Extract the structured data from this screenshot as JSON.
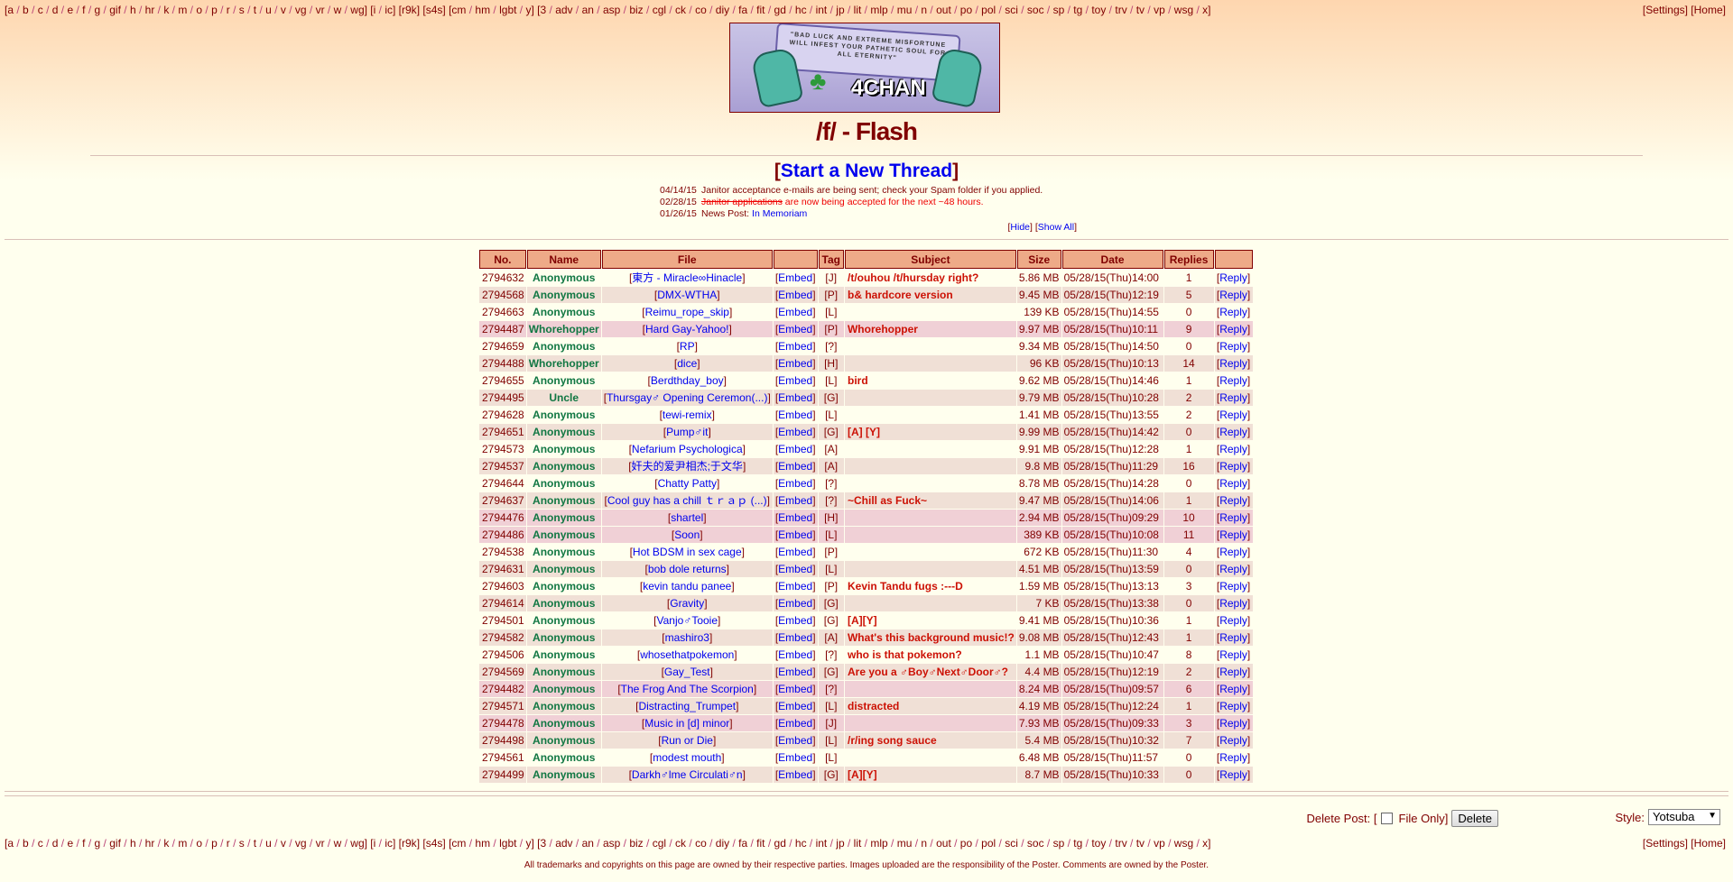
{
  "boards_groups": [
    [
      "a",
      "b",
      "c",
      "d",
      "e",
      "f",
      "g",
      "gif",
      "h",
      "hr",
      "k",
      "m",
      "o",
      "p",
      "r",
      "s",
      "t",
      "u",
      "v",
      "vg",
      "vr",
      "w",
      "wg"
    ],
    [
      "i",
      "ic"
    ],
    [
      "r9k"
    ],
    [
      "s4s"
    ],
    [
      "cm",
      "hm",
      "lgbt",
      "y"
    ],
    [
      "3",
      "adv",
      "an",
      "asp",
      "biz",
      "cgl",
      "ck",
      "co",
      "diy",
      "fa",
      "fit",
      "gd",
      "hc",
      "int",
      "jp",
      "lit",
      "mlp",
      "mu",
      "n",
      "out",
      "po",
      "pol",
      "sci",
      "soc",
      "sp",
      "tg",
      "toy",
      "trv",
      "tv",
      "vp",
      "wsg",
      "x"
    ]
  ],
  "nav_right": {
    "settings": "Settings",
    "home": "Home"
  },
  "banner": {
    "text": "\"BAD LUCK AND EXTREME MISFORTUNE WILL INFEST YOUR PATHETIC SOUL FOR ALL ETERNITY\"",
    "logo": "4CHAN"
  },
  "board_title": "/f/ - Flash",
  "start_thread": "Start a New Thread",
  "news": [
    {
      "date": "04/14/15",
      "text": "Janitor acceptance e-mails are being sent; check your Spam folder if you applied."
    },
    {
      "date": "02/28/15",
      "strike": "Janitor applications",
      "text": " are now being accepted for the next ~48 hours."
    },
    {
      "date": "01/26/15",
      "text": "News Post: ",
      "link": "In Memoriam"
    }
  ],
  "news_ctl": {
    "hide": "Hide",
    "show_all": "Show All"
  },
  "table": {
    "headers": [
      "No.",
      "Name",
      "File",
      "",
      "Tag",
      "Subject",
      "Size",
      "Date",
      "Replies",
      ""
    ],
    "embed_label": "Embed",
    "reply_label": "Reply",
    "rows": [
      {
        "no": "2794632",
        "name": "Anonymous",
        "file": "東方 - Miracle∞Hinacle",
        "tag": "J",
        "subj": "/t/ouhou /t/hursday right?",
        "size": "5.86 MB",
        "date": "05/28/15(Thu)14:00",
        "rep": "1"
      },
      {
        "no": "2794568",
        "name": "Anonymous",
        "file": "DMX-WTHA",
        "tag": "P",
        "subj": "b& hardcore version",
        "size": "9.45 MB",
        "date": "05/28/15(Thu)12:19",
        "rep": "5"
      },
      {
        "no": "2794663",
        "name": "Anonymous",
        "file": "Reimu_rope_skip",
        "tag": "L",
        "subj": "",
        "size": "139 KB",
        "date": "05/28/15(Thu)14:55",
        "rep": "0"
      },
      {
        "no": "2794487",
        "name": "Whorehopper",
        "file": "Hard Gay-Yahoo!",
        "tag": "P",
        "subj": "Whorehopper",
        "size": "9.97 MB",
        "date": "05/28/15(Thu)10:11",
        "rep": "9",
        "hl": true
      },
      {
        "no": "2794659",
        "name": "Anonymous",
        "file": "RP",
        "tag": "?",
        "subj": "",
        "size": "9.34 MB",
        "date": "05/28/15(Thu)14:50",
        "rep": "0"
      },
      {
        "no": "2794488",
        "name": "Whorehopper",
        "file": "dice",
        "tag": "H",
        "subj": "",
        "size": "96 KB",
        "date": "05/28/15(Thu)10:13",
        "rep": "14"
      },
      {
        "no": "2794655",
        "name": "Anonymous",
        "file": "Berdthday_boy",
        "tag": "L",
        "subj": "bird",
        "size": "9.62 MB",
        "date": "05/28/15(Thu)14:46",
        "rep": "1"
      },
      {
        "no": "2794495",
        "name": "Uncle",
        "file": "Thursgay♂ Opening Ceremon(...)",
        "tag": "G",
        "subj": "",
        "size": "9.79 MB",
        "date": "05/28/15(Thu)10:28",
        "rep": "2"
      },
      {
        "no": "2794628",
        "name": "Anonymous",
        "file": "tewi-remix",
        "tag": "L",
        "subj": "",
        "size": "1.41 MB",
        "date": "05/28/15(Thu)13:55",
        "rep": "2"
      },
      {
        "no": "2794651",
        "name": "Anonymous",
        "file": "Pump♂it",
        "tag": "G",
        "subj": "[A] [Y]",
        "size": "9.99 MB",
        "date": "05/28/15(Thu)14:42",
        "rep": "0"
      },
      {
        "no": "2794573",
        "name": "Anonymous",
        "file": "Nefarium Psychologica",
        "tag": "A",
        "subj": "",
        "size": "9.91 MB",
        "date": "05/28/15(Thu)12:28",
        "rep": "1"
      },
      {
        "no": "2794537",
        "name": "Anonymous",
        "file": "奸夫的爱尹相杰;于文华",
        "tag": "A",
        "subj": "",
        "size": "9.8 MB",
        "date": "05/28/15(Thu)11:29",
        "rep": "16"
      },
      {
        "no": "2794644",
        "name": "Anonymous",
        "file": "Chatty Patty",
        "tag": "?",
        "subj": "",
        "size": "8.78 MB",
        "date": "05/28/15(Thu)14:28",
        "rep": "0"
      },
      {
        "no": "2794637",
        "name": "Anonymous",
        "file": "Cool guy has a chill ｔｒａｐ (...)",
        "tag": "?",
        "subj": "~Chill as Fuck~",
        "size": "9.47 MB",
        "date": "05/28/15(Thu)14:06",
        "rep": "1"
      },
      {
        "no": "2794476",
        "name": "Anonymous",
        "file": "shartel",
        "tag": "H",
        "subj": "",
        "size": "2.94 MB",
        "date": "05/28/15(Thu)09:29",
        "rep": "10",
        "hl": true
      },
      {
        "no": "2794486",
        "name": "Anonymous",
        "file": "Soon",
        "tag": "L",
        "subj": "",
        "size": "389 KB",
        "date": "05/28/15(Thu)10:08",
        "rep": "11",
        "hl": true
      },
      {
        "no": "2794538",
        "name": "Anonymous",
        "file": "Hot BDSM in sex cage",
        "tag": "P",
        "subj": "",
        "size": "672 KB",
        "date": "05/28/15(Thu)11:30",
        "rep": "4"
      },
      {
        "no": "2794631",
        "name": "Anonymous",
        "file": "bob dole returns",
        "tag": "L",
        "subj": "",
        "size": "4.51 MB",
        "date": "05/28/15(Thu)13:59",
        "rep": "0"
      },
      {
        "no": "2794603",
        "name": "Anonymous",
        "file": "kevin tandu panee",
        "tag": "P",
        "subj": "Kevin Tandu fugs :---D",
        "size": "1.59 MB",
        "date": "05/28/15(Thu)13:13",
        "rep": "3"
      },
      {
        "no": "2794614",
        "name": "Anonymous",
        "file": "Gravity",
        "tag": "G",
        "subj": "",
        "size": "7 KB",
        "date": "05/28/15(Thu)13:38",
        "rep": "0"
      },
      {
        "no": "2794501",
        "name": "Anonymous",
        "file": "Vanjo♂Tooie",
        "tag": "G",
        "subj": "[A][Y]",
        "size": "9.41 MB",
        "date": "05/28/15(Thu)10:36",
        "rep": "1"
      },
      {
        "no": "2794582",
        "name": "Anonymous",
        "file": "mashiro3",
        "tag": "A",
        "subj": "What's this background music!?",
        "size": "9.08 MB",
        "date": "05/28/15(Thu)12:43",
        "rep": "1"
      },
      {
        "no": "2794506",
        "name": "Anonymous",
        "file": "whosethatpokemon",
        "tag": "?",
        "subj": "who is that pokemon?",
        "size": "1.1 MB",
        "date": "05/28/15(Thu)10:47",
        "rep": "8"
      },
      {
        "no": "2794569",
        "name": "Anonymous",
        "file": "Gay_Test",
        "tag": "G",
        "subj": "Are you a ♂Boy♂Next♂Door♂?",
        "size": "4.4 MB",
        "date": "05/28/15(Thu)12:19",
        "rep": "2"
      },
      {
        "no": "2794482",
        "name": "Anonymous",
        "file": "The Frog And The Scorpion",
        "tag": "?",
        "subj": "",
        "size": "8.24 MB",
        "date": "05/28/15(Thu)09:57",
        "rep": "6",
        "hl": true
      },
      {
        "no": "2794571",
        "name": "Anonymous",
        "file": "Distracting_Trumpet",
        "tag": "L",
        "subj": "distracted",
        "size": "4.19 MB",
        "date": "05/28/15(Thu)12:24",
        "rep": "1"
      },
      {
        "no": "2794478",
        "name": "Anonymous",
        "file": "Music in [d] minor",
        "tag": "J",
        "subj": "",
        "size": "7.93 MB",
        "date": "05/28/15(Thu)09:33",
        "rep": "3",
        "hl": true
      },
      {
        "no": "2794498",
        "name": "Anonymous",
        "file": "Run or Die",
        "tag": "L",
        "subj": "/r/ing song sauce",
        "size": "5.4 MB",
        "date": "05/28/15(Thu)10:32",
        "rep": "7"
      },
      {
        "no": "2794561",
        "name": "Anonymous",
        "file": "modest mouth",
        "tag": "L",
        "subj": "",
        "size": "6.48 MB",
        "date": "05/28/15(Thu)11:57",
        "rep": "0"
      },
      {
        "no": "2794499",
        "name": "Anonymous",
        "file": "Darkh♂lme Circulati♂n",
        "tag": "G",
        "subj": "[A][Y]",
        "size": "8.7 MB",
        "date": "05/28/15(Thu)10:33",
        "rep": "0"
      }
    ]
  },
  "delete": {
    "label": "Delete Post: [",
    "file_only": "File Only]",
    "button": "Delete"
  },
  "style": {
    "label": "Style:",
    "selected": "Yotsuba"
  },
  "footer": "All trademarks and copyrights on this page are owned by their respective parties. Images uploaded are the responsibility of the Poster. Comments are owned by the Poster."
}
